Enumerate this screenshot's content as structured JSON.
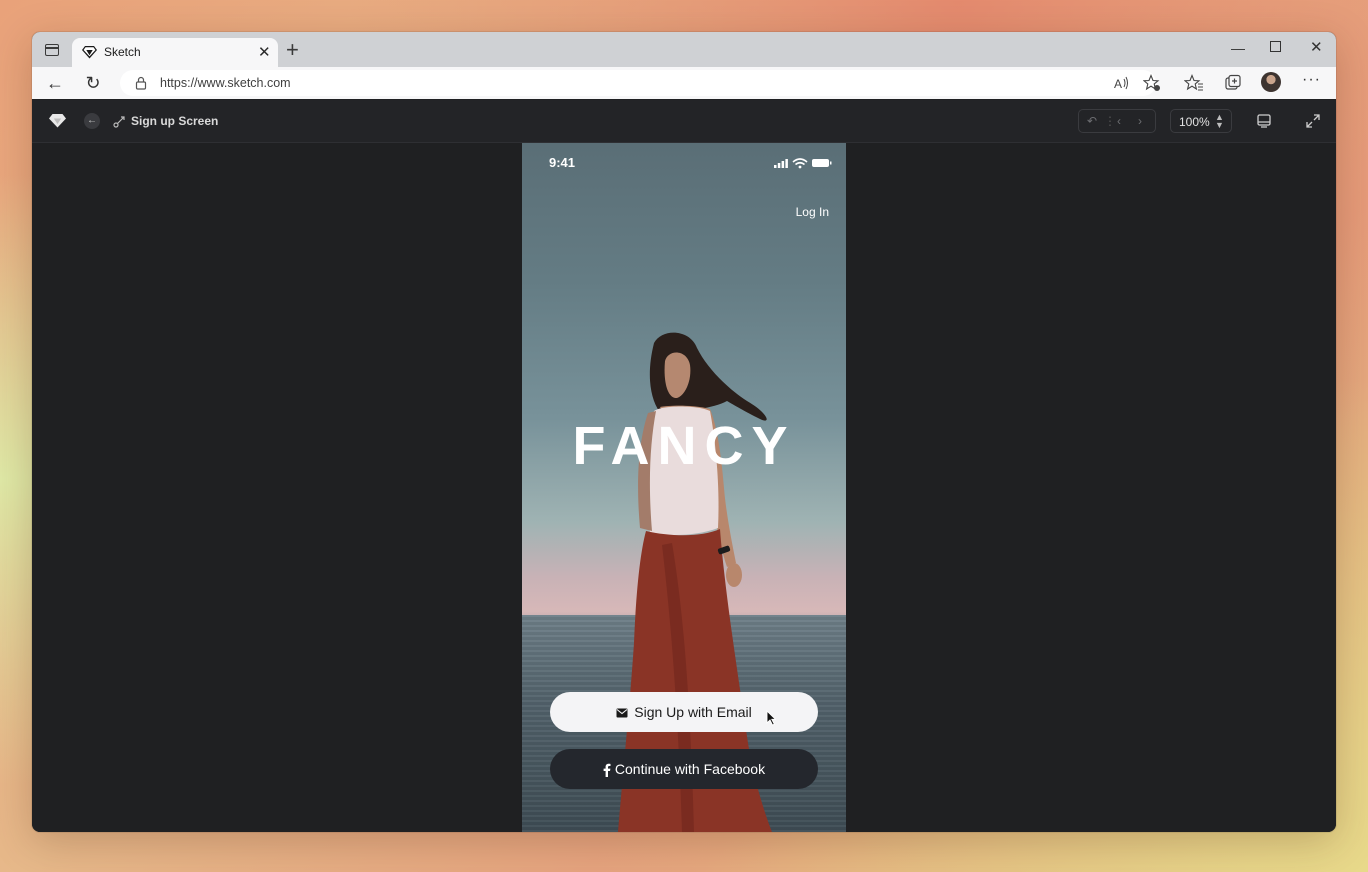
{
  "browser": {
    "tab_title": "Sketch",
    "url": "https://www.sketch.com",
    "icons": [
      "sidebar-panel-icon",
      "sketch-favicon",
      "close-icon",
      "new-tab-icon",
      "minimize-icon",
      "maximize-icon",
      "window-close-icon",
      "back-icon",
      "refresh-icon",
      "lock-icon",
      "read-aloud-icon",
      "add-favorite-icon",
      "favorites-icon",
      "collections-icon",
      "avatar",
      "more-icon"
    ]
  },
  "sketch": {
    "screen_title": "Sign up Screen",
    "zoom": "100%"
  },
  "phone": {
    "time": "9:41",
    "login_label": "Log In",
    "brand": "FANCY",
    "email_button": "Sign Up with Email",
    "facebook_button": "Continue with Facebook"
  }
}
